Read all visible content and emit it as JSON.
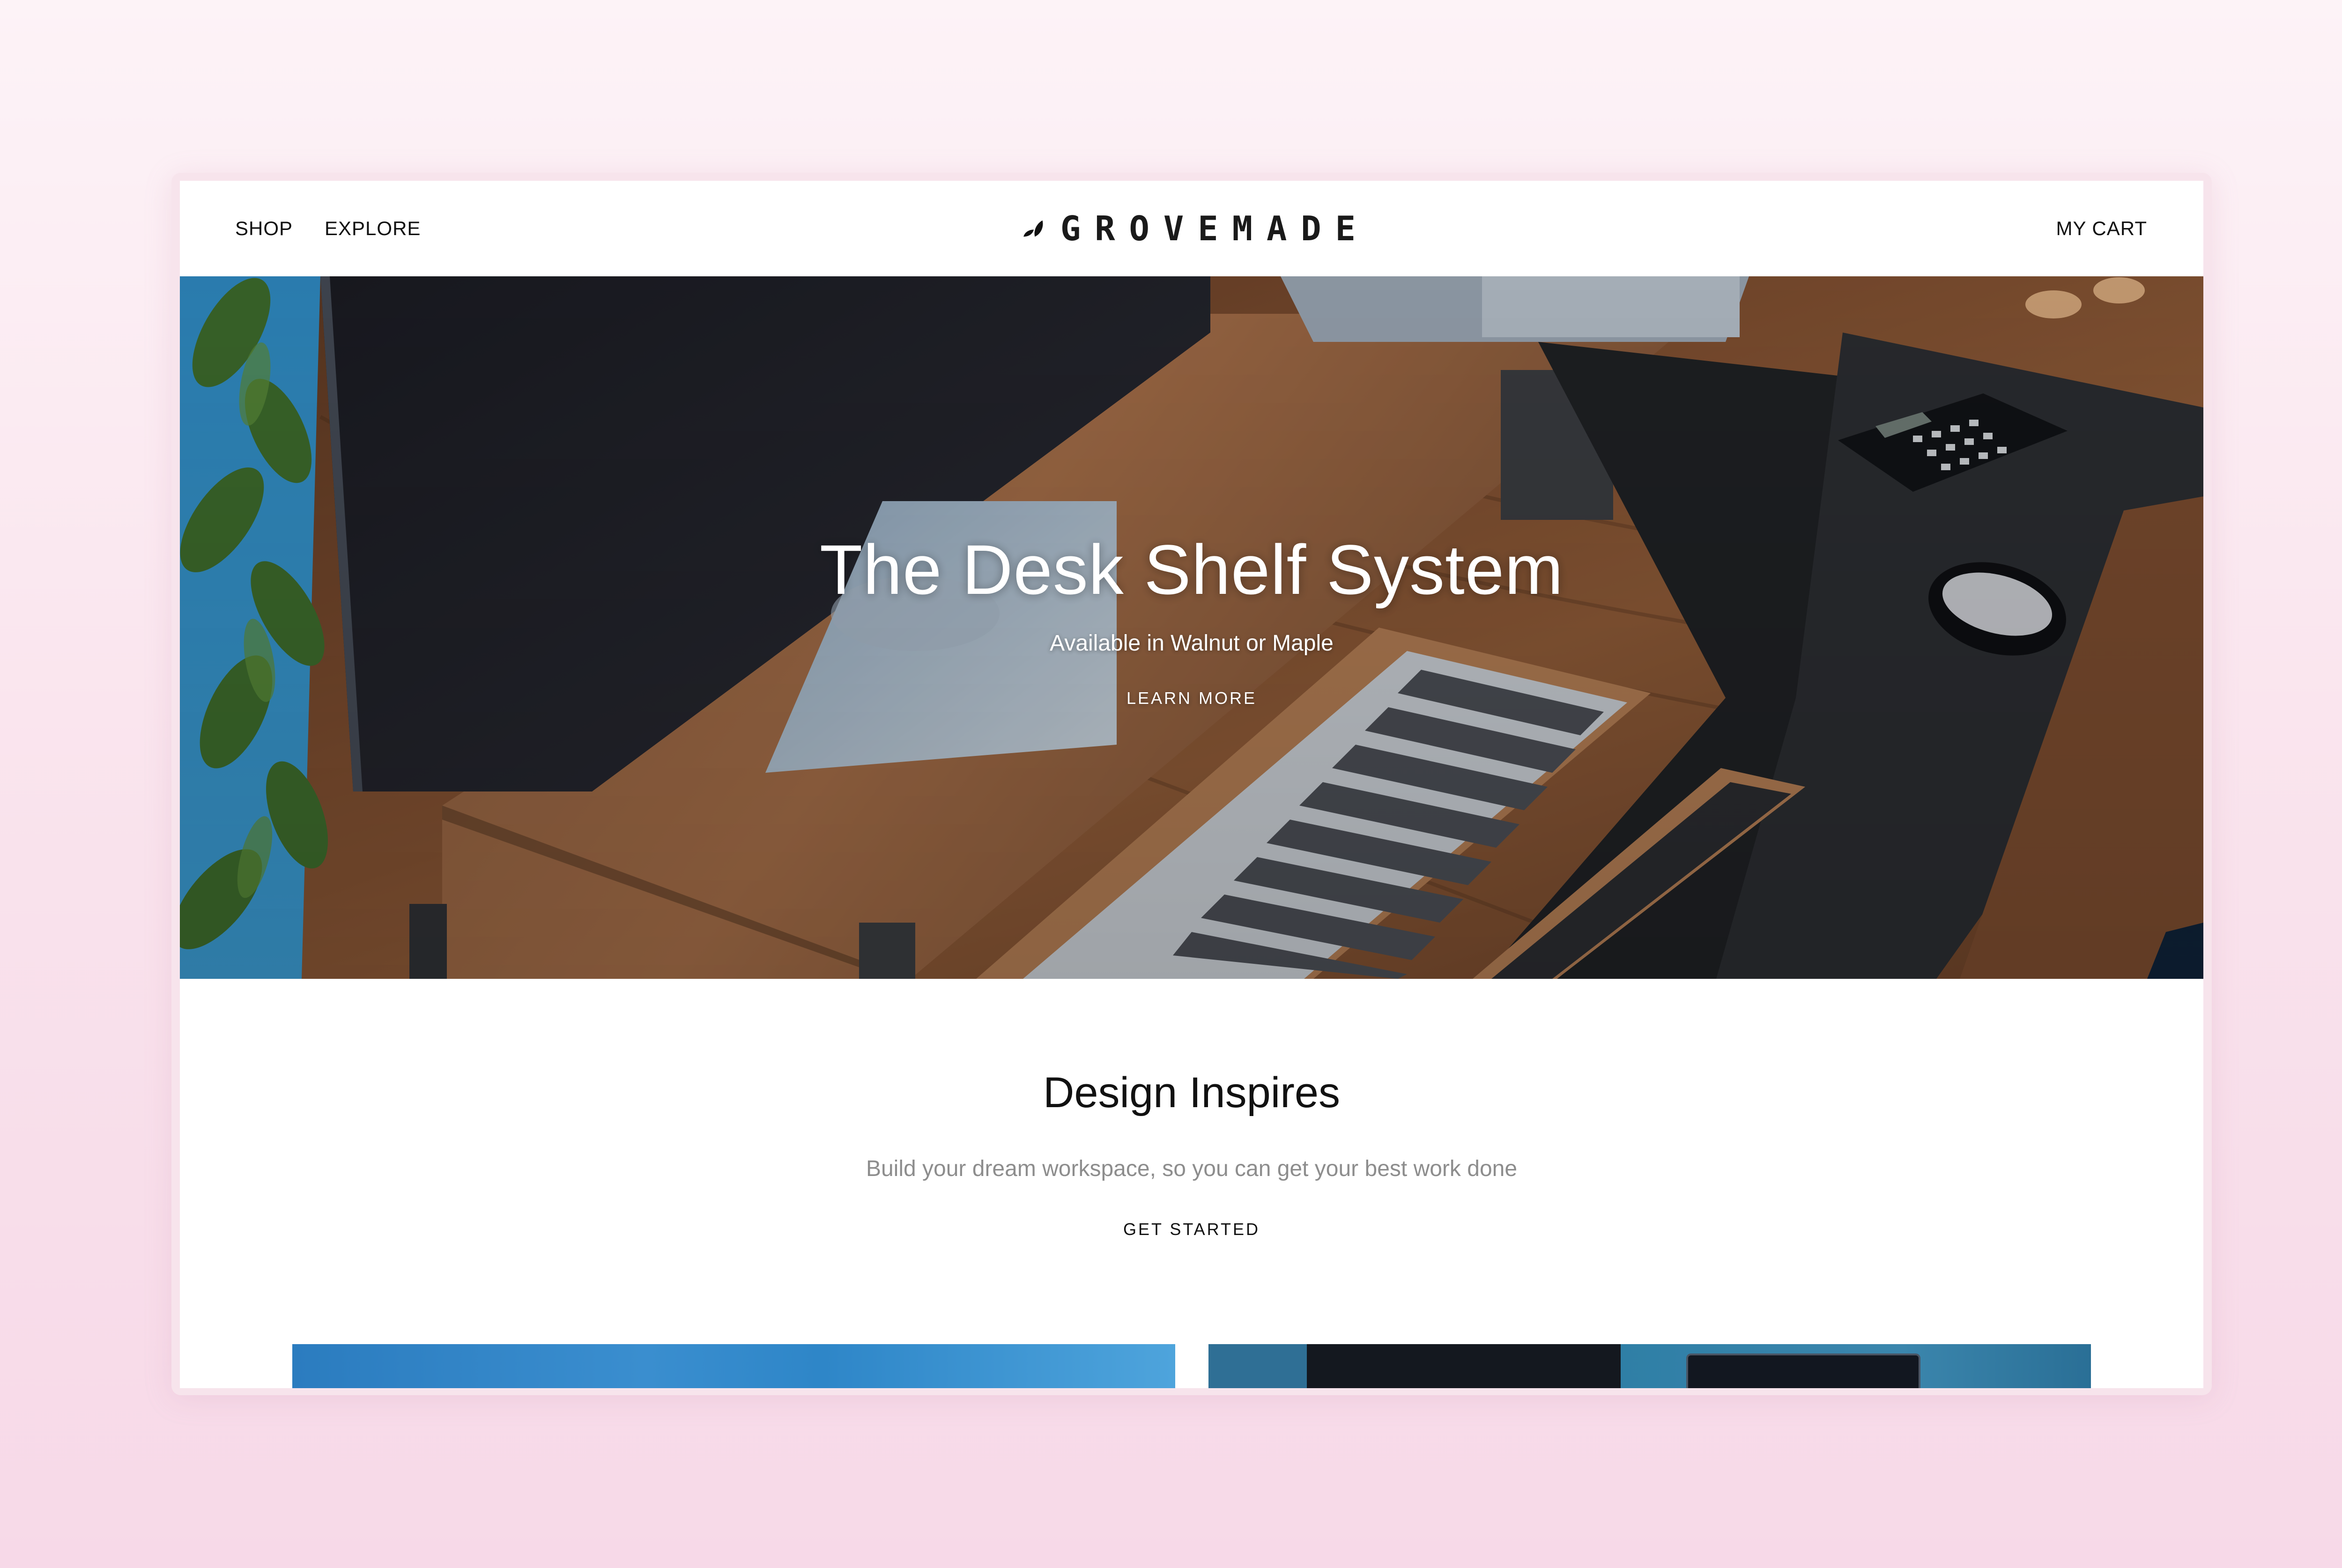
{
  "nav": {
    "shop_label": "SHOP",
    "explore_label": "EXPLORE",
    "cart_label": "MY CART"
  },
  "brand": {
    "logo_text": "GROVEMADE",
    "logo_icon": "leaf-logo-icon"
  },
  "hero": {
    "title": "The Desk Shelf System",
    "subtitle": "Available in Walnut or Maple",
    "cta_label": "LEARN MORE"
  },
  "intro": {
    "title": "Design Inspires",
    "subtitle": "Build your dream workspace, so you can get your best work done",
    "cta_label": "GET STARTED"
  },
  "colors": {
    "background": "#fbe9f1",
    "text": "#111111",
    "muted_text": "#8d8d8d",
    "hero_text": "#ffffff"
  }
}
